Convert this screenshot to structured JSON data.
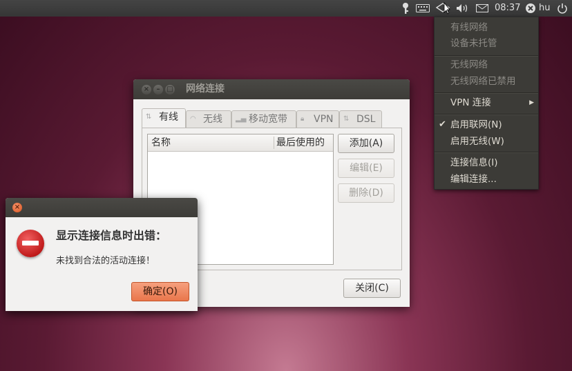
{
  "panel": {
    "time": "08:37",
    "user": "hu"
  },
  "network_menu": {
    "wired_header": "有线网络",
    "wired_status": "设备未托管",
    "wireless_header": "无线网络",
    "wireless_status": "无线网络已禁用",
    "vpn": "VPN 连接",
    "enable_networking": "启用联网(N)",
    "enable_wireless": "启用无线(W)",
    "connection_info": "连接信息(I)",
    "edit_connections": "编辑连接..."
  },
  "net_window": {
    "title": "网络连接",
    "tabs": [
      "有线",
      "无线",
      "移动宽带",
      "VPN",
      "DSL"
    ],
    "columns": [
      "名称",
      "最后使用的"
    ],
    "add": "添加(A)",
    "edit": "编辑(E)",
    "delete": "删除(D)",
    "close": "关闭(C)"
  },
  "error_dialog": {
    "heading": "显示连接信息时出错：",
    "message": "未找到合法的活动连接！",
    "ok": "确定(O)"
  },
  "colors": {
    "panel": "#3c3c3c",
    "accent_orange": "#e9764b",
    "error_red": "#c01b1b"
  },
  "icons": [
    "key-icon",
    "keyboard-icon",
    "network-icon",
    "volume-icon",
    "mail-icon",
    "user-status-icon",
    "power-icon",
    "stop-icon"
  ]
}
